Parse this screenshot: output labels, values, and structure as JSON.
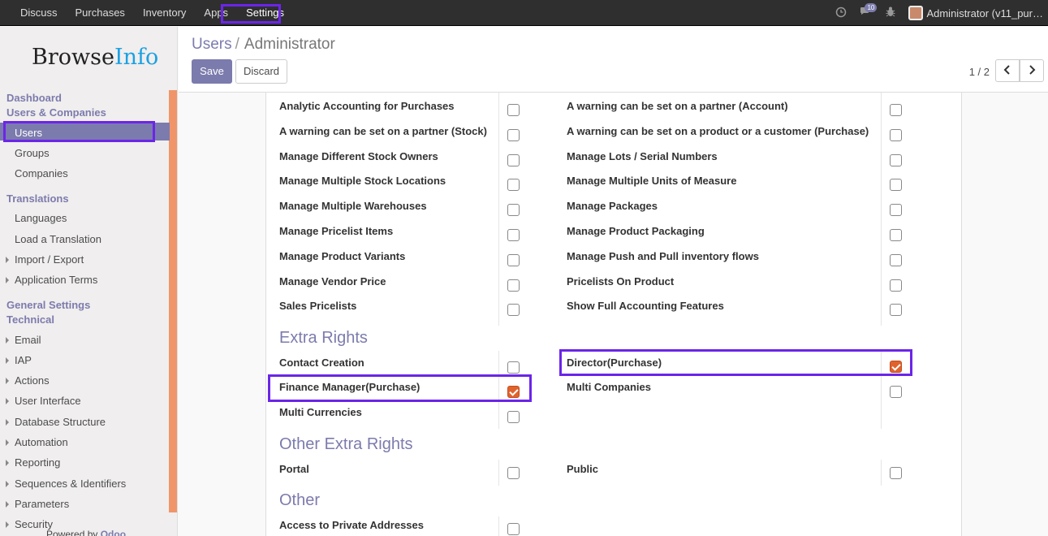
{
  "topbar": {
    "menu": [
      "Discuss",
      "Purchases",
      "Inventory",
      "Apps",
      "Settings"
    ],
    "active": "Settings",
    "chat_count": "10",
    "user": "Administrator (v11_pur…"
  },
  "sidebar": {
    "logo_browse": "Browse",
    "logo_info": "Info",
    "dashboard": "Dashboard",
    "users_companies": "Users & Companies",
    "users": "Users",
    "groups": "Groups",
    "companies": "Companies",
    "translations": "Translations",
    "languages": "Languages",
    "load_translation": "Load a Translation",
    "import_export": "Import / Export",
    "application_terms": "Application Terms",
    "general_settings": "General Settings",
    "technical": "Technical",
    "email": "Email",
    "iap": "IAP",
    "actions": "Actions",
    "user_interface": "User Interface",
    "database_structure": "Database Structure",
    "automation": "Automation",
    "reporting": "Reporting",
    "sequences": "Sequences & Identifiers",
    "parameters": "Parameters",
    "security": "Security",
    "powered_by": "Powered by",
    "odoo": "Odoo"
  },
  "control_panel": {
    "breadcrumb_parent": "Users",
    "breadcrumb_sep": "/",
    "breadcrumb_current": "Administrator",
    "save": "Save",
    "discard": "Discard",
    "pager": "1 / 2"
  },
  "form": {
    "rows": [
      {
        "left": "Analytic Accounting for Purchases",
        "left_checked": false,
        "right": "A warning can be set on a partner (Account)",
        "right_checked": false
      },
      {
        "left": "A warning can be set on a partner (Stock)",
        "left_checked": false,
        "right": "A warning can be set on a product or a customer (Purchase)",
        "right_checked": false
      },
      {
        "left": "Manage Different Stock Owners",
        "left_checked": false,
        "right": "Manage Lots / Serial Numbers",
        "right_checked": false
      },
      {
        "left": "Manage Multiple Stock Locations",
        "left_checked": false,
        "right": "Manage Multiple Units of Measure",
        "right_checked": false
      },
      {
        "left": "Manage Multiple Warehouses",
        "left_checked": false,
        "right": "Manage Packages",
        "right_checked": false
      },
      {
        "left": "Manage Pricelist Items",
        "left_checked": false,
        "right": "Manage Product Packaging",
        "right_checked": false
      },
      {
        "left": "Manage Product Variants",
        "left_checked": false,
        "right": "Manage Push and Pull inventory flows",
        "right_checked": false
      },
      {
        "left": "Manage Vendor Price",
        "left_checked": false,
        "right": "Pricelists On Product",
        "right_checked": false
      },
      {
        "left": "Sales Pricelists",
        "left_checked": false,
        "right": "Show Full Accounting Features",
        "right_checked": false
      }
    ],
    "extra_rights_title": "Extra Rights",
    "extra_rights": {
      "contact_creation": "Contact Creation",
      "director_purchase": "Director(Purchase)",
      "finance_manager": "Finance Manager(Purchase)",
      "multi_companies": "Multi Companies",
      "multi_currencies": "Multi Currencies"
    },
    "other_extra_rights_title": "Other Extra Rights",
    "other_extra_rights": {
      "portal": "Portal",
      "public": "Public"
    },
    "other_title": "Other",
    "other": {
      "private_addresses": "Access to Private Addresses"
    }
  },
  "colors": {
    "accent": "#7c7bad",
    "highlight": "#6b25e8",
    "checkbox_checked": "#e0632e",
    "scrollbar": "#f0956a"
  }
}
